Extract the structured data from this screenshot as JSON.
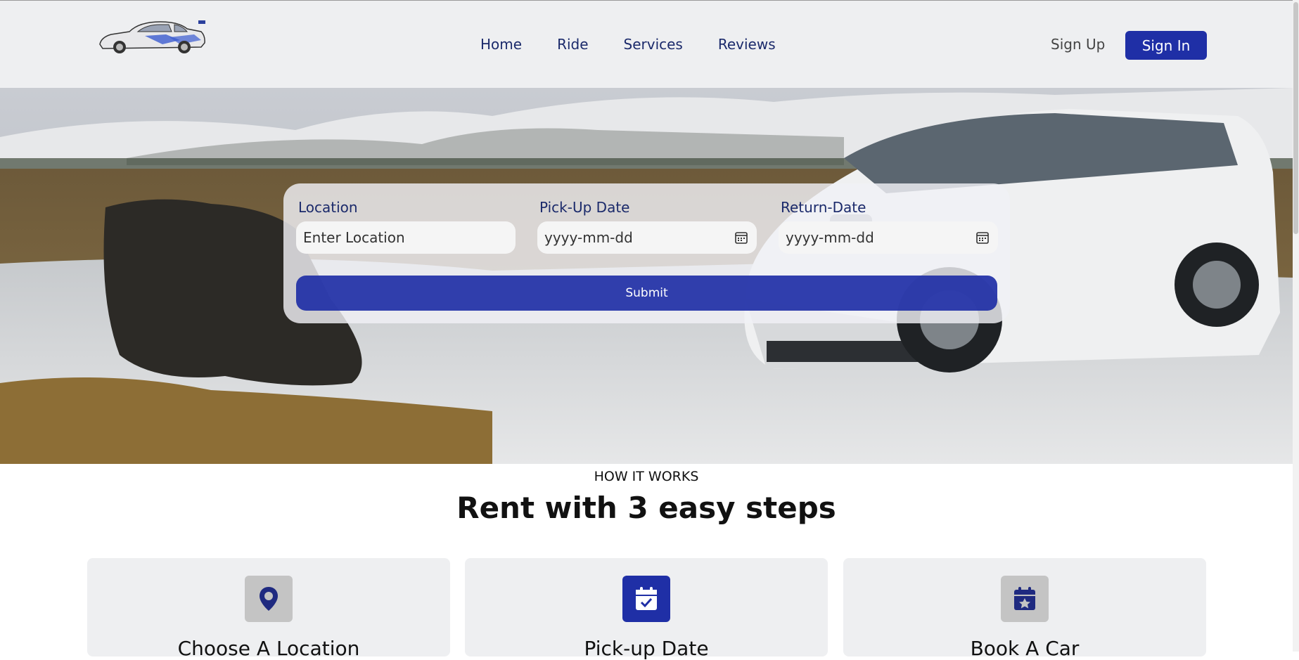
{
  "nav": {
    "items": [
      "Home",
      "Ride",
      "Services",
      "Reviews"
    ],
    "sign_up": "Sign Up",
    "sign_in": "Sign In"
  },
  "booking": {
    "location_label": "Location",
    "location_placeholder": "Enter Location",
    "pickup_label": "Pick-Up Date",
    "pickup_placeholder": "yyyy-mm-dd",
    "return_label": "Return-Date",
    "return_placeholder": "yyyy-mm-dd",
    "submit": "Submit"
  },
  "how_it_works": {
    "eyebrow": "HOW IT WORKS",
    "heading": "Rent with 3 easy steps",
    "steps": [
      {
        "title": "Choose A Location",
        "icon": "location-pin-icon",
        "icon_bg": "#c4c4c4"
      },
      {
        "title": "Pick-up Date",
        "icon": "calendar-check-icon",
        "icon_bg": "#1f2fa6"
      },
      {
        "title": "Book A Car",
        "icon": "calendar-star-icon",
        "icon_bg": "#c4c4c4"
      }
    ]
  },
  "colors": {
    "accent": "#1f2fa6",
    "nav_text": "#1b2a6b",
    "header_bg": "#eeeff1"
  }
}
